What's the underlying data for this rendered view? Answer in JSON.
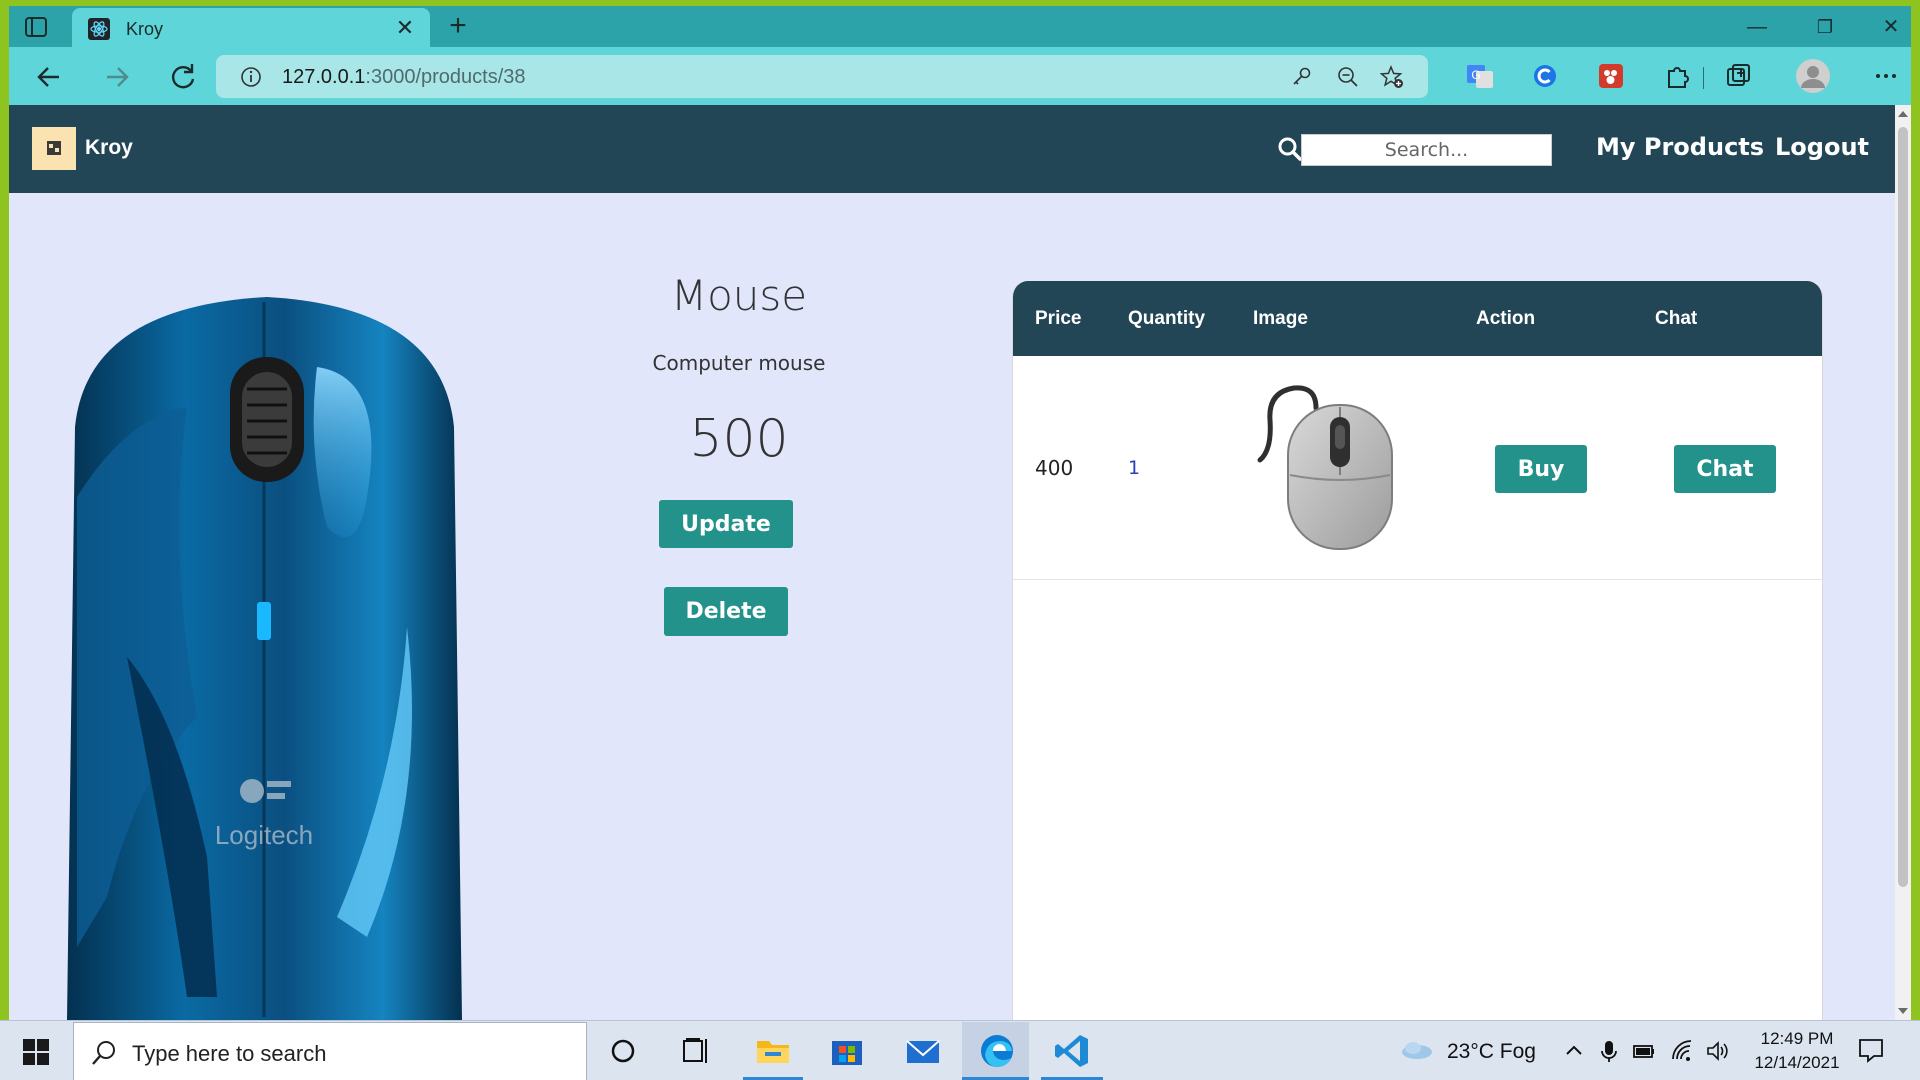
{
  "browser": {
    "tab_title": "Kroy",
    "url_host": "127.0.0.1",
    "url_path": ":3000/products/38",
    "icons": {
      "sidebar": "tab-actions-icon",
      "favicon": "react-icon",
      "close": "close-icon",
      "new_tab": "plus-icon",
      "back": "back-arrow-icon",
      "forward": "forward-arrow-icon",
      "reload": "reload-icon",
      "info": "info-icon",
      "key": "key-icon",
      "zoom": "zoom-out-icon",
      "favorite": "add-favorite-icon",
      "translate": "translate-icon",
      "grammarly": "c-extension-icon",
      "photo_ext": "photo-extension-icon",
      "extensions": "puzzle-icon",
      "collections": "collections-icon",
      "profile": "profile-icon",
      "menu": "more-icon"
    },
    "close_glyph": "✕",
    "new_tab_glyph": "+",
    "win_minimize": "—",
    "win_restore": "❐",
    "win_close": "✕"
  },
  "navbar": {
    "brand": "Kroy",
    "search_placeholder": "Search...",
    "links": [
      "My Products",
      "Logout"
    ]
  },
  "product": {
    "title": "Mouse",
    "description": "Computer mouse",
    "price": "500",
    "update_label": "Update",
    "delete_label": "Delete",
    "image_brand_text": "Logitech"
  },
  "offers_table": {
    "headers": [
      "Price",
      "Quantity",
      "Image",
      "Action",
      "Chat"
    ],
    "rows": [
      {
        "price": "400",
        "quantity": "1",
        "image": "mouse-thumbnail",
        "action": "Buy",
        "chat": "Chat"
      }
    ]
  },
  "taskbar": {
    "search_text": "Type here to search",
    "weather": "23°C  Fog",
    "time": "12:49 PM",
    "date": "12/14/2021",
    "apps": [
      "cortana-icon",
      "task-view-icon",
      "file-explorer-icon",
      "microsoft-store-icon",
      "mail-icon",
      "edge-icon",
      "vscode-icon"
    ]
  },
  "colors": {
    "browser_frame": "#2ba3a8",
    "toolbar": "#5ed5d8",
    "navbar": "#234657",
    "page_bg": "#e2e6fb",
    "accent_button": "#22928a",
    "quantity_link": "#2c3fb8"
  }
}
